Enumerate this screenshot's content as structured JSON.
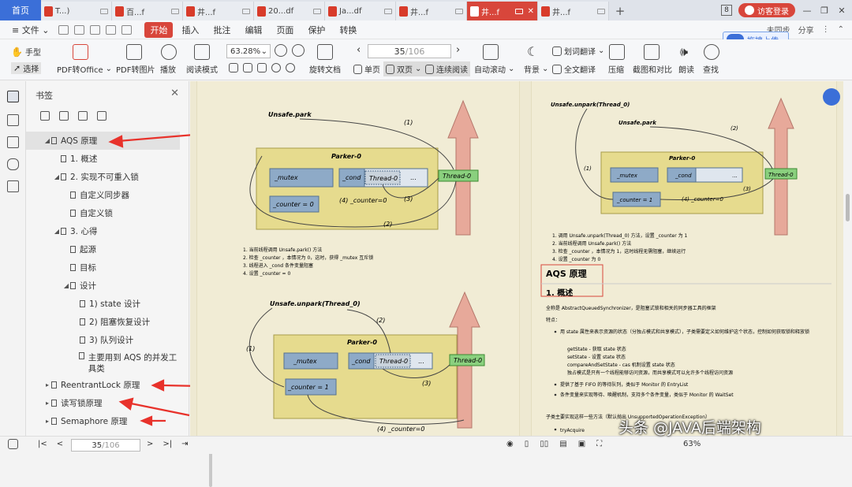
{
  "tabs": {
    "home": "首页",
    "items": [
      {
        "label": "T...)"
      },
      {
        "label": "百...f"
      },
      {
        "label": "井...f"
      },
      {
        "label": "20...df"
      },
      {
        "label": "Ja...df"
      },
      {
        "label": "井...f"
      },
      {
        "label": "井...f",
        "active": true
      },
      {
        "label": "井...f"
      }
    ],
    "badge": "8",
    "login": "访客登录"
  },
  "menu": {
    "file": "文件",
    "items": [
      "开始",
      "插入",
      "批注",
      "编辑",
      "页面",
      "保护",
      "转换"
    ],
    "right": [
      "未同步",
      "分享"
    ]
  },
  "toolbar": {
    "hand": "手型",
    "select": "选择",
    "pdf_office": "PDF转Office",
    "pdf_image": "PDF转图片",
    "play": "播放",
    "read_mode": "阅读模式",
    "zoom": "63.28%",
    "rotate": "旋转文档",
    "page_current": "35",
    "page_total": "/106",
    "single": "单页",
    "double": "双页",
    "continuous": "连续阅读",
    "autoscroll": "自动滚动",
    "background": "背景",
    "translate_word": "划词翻译",
    "translate_full": "全文翻译",
    "compress": "压缩",
    "compare": "截图和对比",
    "read": "朗读",
    "find": "查找",
    "upload": "拖拽上传"
  },
  "bookmarks": {
    "title": "书签",
    "items": [
      {
        "level": 0,
        "expand": "down",
        "label": "AQS 原理",
        "selected": true
      },
      {
        "level": 1,
        "expand": "",
        "label": "1. 概述"
      },
      {
        "level": 1,
        "expand": "down",
        "label": "2. 实现不可重入锁"
      },
      {
        "level": 2,
        "expand": "",
        "label": "自定义同步器"
      },
      {
        "level": 2,
        "expand": "",
        "label": "自定义锁"
      },
      {
        "level": 1,
        "expand": "down",
        "label": "3. 心得"
      },
      {
        "level": 2,
        "expand": "",
        "label": "起源"
      },
      {
        "level": 2,
        "expand": "",
        "label": "目标"
      },
      {
        "level": 2,
        "expand": "down",
        "label": "设计"
      },
      {
        "level": 3,
        "expand": "",
        "label": "1) state 设计"
      },
      {
        "level": 3,
        "expand": "",
        "label": "2) 阻塞恢复设计"
      },
      {
        "level": 3,
        "expand": "",
        "label": "3) 队列设计"
      },
      {
        "level": 3,
        "expand": "",
        "label": "主要用到 AQS 的并发工具类",
        "two": true
      },
      {
        "level": 0,
        "expand": "right",
        "label": "ReentrantLock 原理"
      },
      {
        "level": 0,
        "expand": "right",
        "label": "读写锁原理"
      },
      {
        "level": 0,
        "expand": "right",
        "label": "Semaphore 原理"
      }
    ]
  },
  "left_page": {
    "d1": {
      "title": "Unsafe.park",
      "box": "Parker-0",
      "mutex": "_mutex",
      "cond": "_cond",
      "thread": "Thread-0",
      "dots": "...",
      "counter": "_counter = 0",
      "counter_lbl": "(4) _counter=0",
      "s1": "(1)",
      "s2": "(2)",
      "s3": "(3)"
    },
    "notes": [
      "1. 当前线程调用 Unsafe.park() 方法",
      "2. 检查 _counter ，本情况为 0，这时，获得 _mutex 互斥锁",
      "3. 线程进入 _cond 条件变量阻塞",
      "4. 设置 _counter = 0"
    ],
    "d2": {
      "title": "Unsafe.unpark(Thread_0)",
      "box": "Parker-0",
      "mutex": "_mutex",
      "cond": "_cond",
      "thread": "Thread-0",
      "dots": "...",
      "counter": "_counter = 1",
      "counter_lbl": "(4) _counter=0",
      "s1": "(1)",
      "s2": "(2)",
      "s3": "(3)"
    }
  },
  "right_page": {
    "d3": {
      "title": "Unsafe.unpark(Thread_0)",
      "sub": "Unsafe.park",
      "box": "Parker-0",
      "mutex": "_mutex",
      "cond": "_cond",
      "thread": "Thread-0",
      "dots": "...",
      "counter": "_counter = 1",
      "counter_lbl": "(4) _counter=0",
      "s1": "(1)",
      "s2": "(2)",
      "s3": "(3)"
    },
    "notes": [
      "1. 调用 Unsafe.unpark(Thread_0) 方法，设置 _counter 为 1",
      "2. 当前线程调用 Unsafe.park() 方法",
      "3. 检查 _counter ，本情况为 1，这时线程无需阻塞，继续运行",
      "4. 设置 _counter 为 0"
    ],
    "h1": "AQS 原理",
    "h2": "1. 概述",
    "intro": "全称是 AbstractQueuedSynchronizer，是阻塞式锁和相关的同步器工具的框架",
    "feature": "特点：",
    "bullets": [
      "用 state 属性来表示资源的状态（分独占模式和共享模式），子类需要定义如何维护这个状态，控制如何获取锁和释放锁",
      "getState - 获取 state 状态",
      "setState - 设置 state 状态",
      "compareAndSetState - cas 机制设置 state 状态",
      "独占模式是只有一个线程能够访问资源，而共享模式可以允许多个线程访问资源",
      "提供了基于 FIFO 的等待队列，类似于 Monitor 的 EntryList",
      "条件变量来实现等待、唤醒机制，支持多个条件变量，类似于 Monitor 的 WaitSet"
    ],
    "subclass": "子类主要实现这样一些方法（默认抛出 UnsupportedOperationException）",
    "try": "tryAcquire"
  },
  "status": {
    "page_current": "35",
    "page_total": "/106",
    "zoom": "63%",
    "watermark": "头条 @JAVA后端架构"
  }
}
